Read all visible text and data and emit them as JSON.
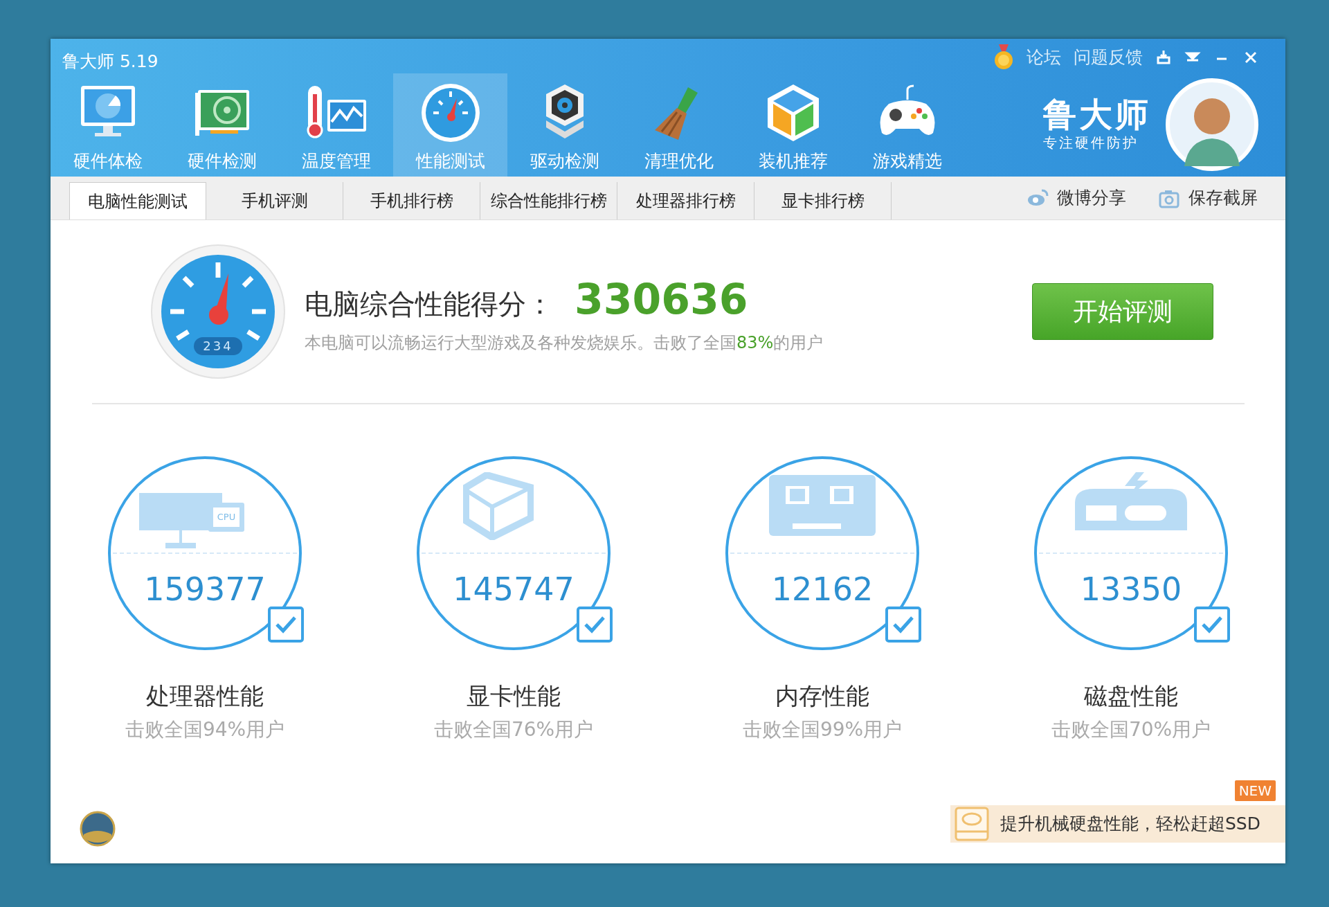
{
  "window": {
    "title": "鲁大师 5.19"
  },
  "top_links": [
    "论坛",
    "问题反馈"
  ],
  "nav": [
    {
      "label": "硬件体检",
      "kind": "monitor",
      "selected": false
    },
    {
      "label": "硬件检测",
      "kind": "card",
      "selected": false
    },
    {
      "label": "温度管理",
      "kind": "thermo",
      "selected": false
    },
    {
      "label": "性能测试",
      "kind": "gauge",
      "selected": true
    },
    {
      "label": "驱动检测",
      "kind": "driver",
      "selected": false
    },
    {
      "label": "清理优化",
      "kind": "broom",
      "selected": false
    },
    {
      "label": "装机推荐",
      "kind": "cube",
      "selected": false
    },
    {
      "label": "游戏精选",
      "kind": "gamepad",
      "selected": false
    }
  ],
  "brand": {
    "name": "鲁大师",
    "slogan": "专注硬件防护"
  },
  "subtabs": [
    {
      "label": "电脑性能测试",
      "selected": true
    },
    {
      "label": "手机评测",
      "selected": false
    },
    {
      "label": "手机排行榜",
      "selected": false
    },
    {
      "label": "综合性能排行榜",
      "selected": false
    },
    {
      "label": "处理器排行榜",
      "selected": false
    },
    {
      "label": "显卡排行榜",
      "selected": false
    }
  ],
  "actions": [
    {
      "label": "微博分享",
      "kind": "weibo"
    },
    {
      "label": "保存截屏",
      "kind": "camera"
    }
  ],
  "score": {
    "dial_reading": "234",
    "label": "电脑综合性能得分：",
    "value": "330636",
    "description": [
      {
        "text": "本电脑可以流畅运行大型游戏及各种发烧娱乐。击败了全国",
        "highlight": false
      },
      {
        "text": "83%",
        "highlight": true
      },
      {
        "text": "的用户",
        "highlight": false
      }
    ],
    "button": "开始评测"
  },
  "components": [
    {
      "kind": "cpu",
      "icon_label": "CPU",
      "score": "159377",
      "checked": true,
      "name": "处理器性能",
      "rank": "击败全国94%用户"
    },
    {
      "kind": "gpu",
      "score": "145747",
      "checked": true,
      "name": "显卡性能",
      "rank": "击败全国76%用户"
    },
    {
      "kind": "memory",
      "score": "12162",
      "checked": true,
      "name": "内存性能",
      "rank": "击败全国99%用户"
    },
    {
      "kind": "disk",
      "score": "13350",
      "checked": true,
      "name": "磁盘性能",
      "rank": "击败全国70%用户"
    }
  ],
  "promo": {
    "badge": "NEW",
    "text": "提升机械硬盘性能，轻松赶超SSD"
  }
}
